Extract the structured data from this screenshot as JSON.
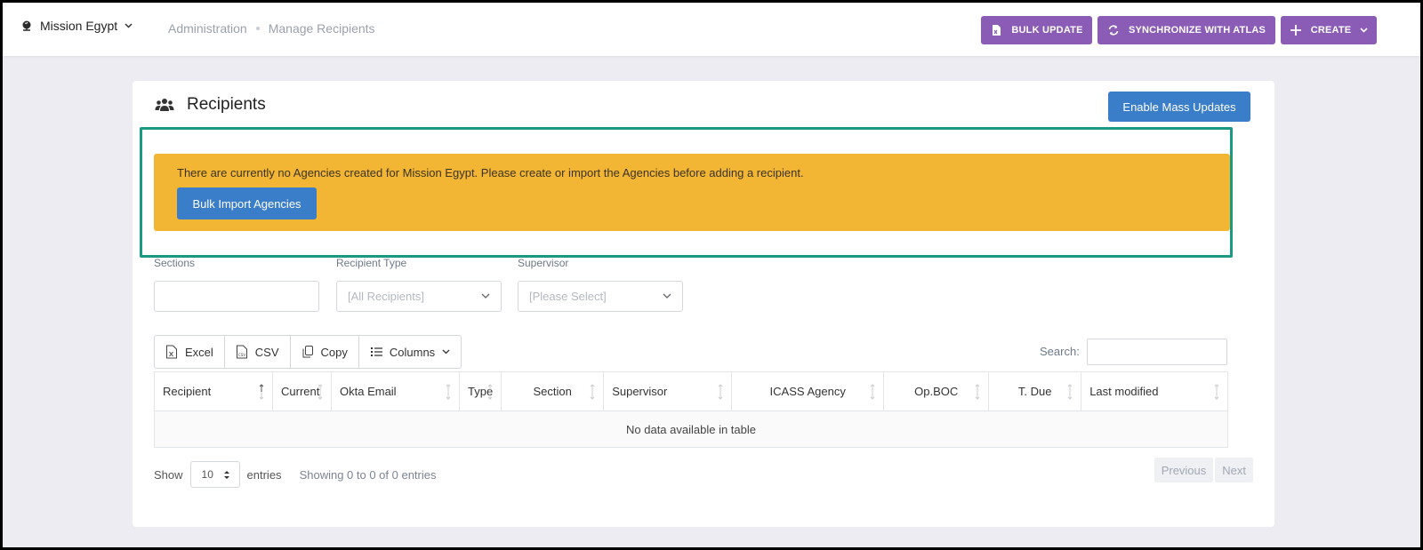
{
  "header": {
    "mission": "Mission Egypt",
    "breadcrumb": [
      "Administration",
      "Manage Recipients"
    ],
    "buttons": {
      "bulk_update": "BULK UPDATE",
      "synchronize": "SYNCHRONIZE WITH ATLAS",
      "create": "CREATE"
    }
  },
  "card": {
    "title": "Recipients",
    "mass_updates": "Enable Mass Updates"
  },
  "alert": {
    "message": "There are currently no Agencies created for Mission Egypt. Please create or import the Agencies before adding a recipient.",
    "button": "Bulk Import Agencies"
  },
  "filters": {
    "sections_label": "Sections",
    "sections_value": "",
    "recipient_type_label": "Recipient Type",
    "recipient_type_value": "[All Recipients]",
    "supervisor_label": "Supervisor",
    "supervisor_value": "[Please Select]"
  },
  "toolbar": {
    "excel": "Excel",
    "csv": "CSV",
    "copy": "Copy",
    "columns": "Columns",
    "search_label": "Search:"
  },
  "table": {
    "columns": [
      "Recipient",
      "Current",
      "Okta Email",
      "Type",
      "Section",
      "Supervisor",
      "ICASS Agency",
      "Op.BOC",
      "T. Due",
      "Last modified"
    ],
    "empty": "No data available in table"
  },
  "footer": {
    "show": "Show",
    "page_length": "10",
    "entries": "entries",
    "info": "Showing 0 to 0 of 0 entries",
    "previous": "Previous",
    "next": "Next"
  },
  "colors": {
    "purple": "#8a5cb5",
    "blue": "#3a7dc9",
    "warning": "#f2b634",
    "highlight": "#1b9a83"
  }
}
